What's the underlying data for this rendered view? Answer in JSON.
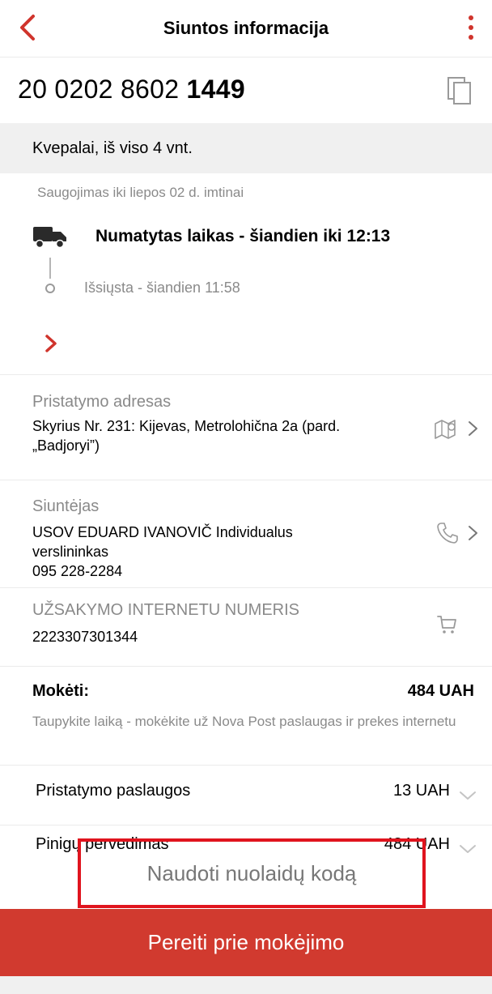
{
  "header": {
    "title": "Siuntos informacija",
    "back_icon": "chevron-left-icon",
    "more_icon": "more-vertical-icon",
    "accent_color": "#d0342c"
  },
  "parcel": {
    "number_prefix": "20 0202 8602 ",
    "number_suffix": "1449",
    "copy_icon": "copy-icon",
    "contents": "Kvepalai, iš viso 4 vnt.",
    "storage": "Saugojimas iki liepos 02 d. imtinai"
  },
  "tracking": {
    "eta": "Numatytas laikas - šiandien iki 12:13",
    "sent": "Išsiųsta - šiandien 11:58",
    "expand_icon": "chevron-right-icon"
  },
  "delivery_address": {
    "label": "Pristatymo adresas",
    "value_line1": "Skyrius Nr. 231: Kijevas, Metrolohična 2a (pard.",
    "value_line2": "„Badjoryi”)",
    "icon": "map-icon"
  },
  "sender": {
    "label": "Siuntėjas",
    "name_line1": "USOV EDUARD IVANOVIČ Individualus",
    "name_line2": "verslininkas",
    "phone": "095 228-2284",
    "icon": "phone-icon"
  },
  "order": {
    "label": "UŽSAKYMO INTERNETU NUMERIS",
    "value": "2223307301344",
    "icon": "cart-icon"
  },
  "payment": {
    "label": "Mokėti:",
    "amount": "484 UAH",
    "note": "Taupykite laiką - mokėkite už Nova Post paslaugas ir prekes internetu"
  },
  "services": [
    {
      "name": "Pristatymo paslaugos",
      "amount": "13 UAH"
    },
    {
      "name": "Pinigų pervedimas",
      "amount": "484 UAH"
    }
  ],
  "promo_button": "Naudoti nuolaidų kodą",
  "pay_button": "Pereiti prie mokėjimo",
  "colors": {
    "button_bg": "#d13a2f",
    "highlight_border": "#e0141e",
    "grey_bar": "#f0f0f0"
  }
}
